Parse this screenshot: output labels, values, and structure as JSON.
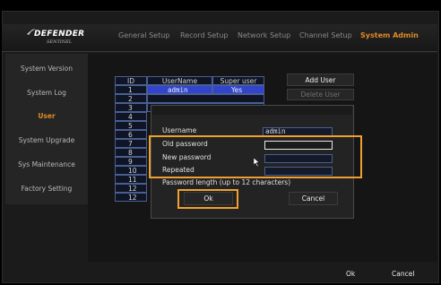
{
  "logo": {
    "brand": "DEFENDER",
    "sub": "SENTINEL"
  },
  "nav": {
    "tabs": [
      {
        "label": "General Setup"
      },
      {
        "label": "Record Setup"
      },
      {
        "label": "Network Setup"
      },
      {
        "label": "Channel Setup"
      },
      {
        "label": "System Admin",
        "active": true
      }
    ]
  },
  "sidebar": {
    "items": [
      {
        "label": "System Version"
      },
      {
        "label": "System Log"
      },
      {
        "label": "User",
        "active": true
      },
      {
        "label": "System Upgrade"
      },
      {
        "label": "Sys Maintenance"
      },
      {
        "label": "Factory Setting"
      }
    ]
  },
  "users_table": {
    "headers": [
      "ID",
      "UserName",
      "Super user"
    ],
    "rows": [
      {
        "id": "1",
        "username": "admin",
        "super": "Yes"
      },
      {
        "id": "2",
        "username": "",
        "super": ""
      },
      {
        "id": "3",
        "username": "",
        "super": ""
      },
      {
        "id": "4",
        "username": "",
        "super": ""
      },
      {
        "id": "5",
        "username": "",
        "super": ""
      },
      {
        "id": "6",
        "username": "",
        "super": ""
      },
      {
        "id": "7",
        "username": "",
        "super": ""
      },
      {
        "id": "8",
        "username": "",
        "super": ""
      },
      {
        "id": "9",
        "username": "",
        "super": ""
      },
      {
        "id": "10",
        "username": "",
        "super": ""
      },
      {
        "id": "11",
        "username": "",
        "super": ""
      },
      {
        "id": "12",
        "username": "",
        "super": ""
      }
    ]
  },
  "actions": {
    "add_user": "Add User",
    "delete_user": "Delete User"
  },
  "dialog": {
    "username_label": "Username",
    "username_value": "admin",
    "old_password_label": "Old password",
    "new_password_label": "New password",
    "repeated_label": "Repeated",
    "hint": "Password length (up to 12 characters)",
    "ok": "Ok",
    "cancel": "Cancel"
  },
  "footer": {
    "ok": "Ok",
    "cancel": "Cancel"
  },
  "colors": {
    "accent": "#e08a24",
    "highlight": "#f0a030",
    "selection": "#3344cc"
  }
}
